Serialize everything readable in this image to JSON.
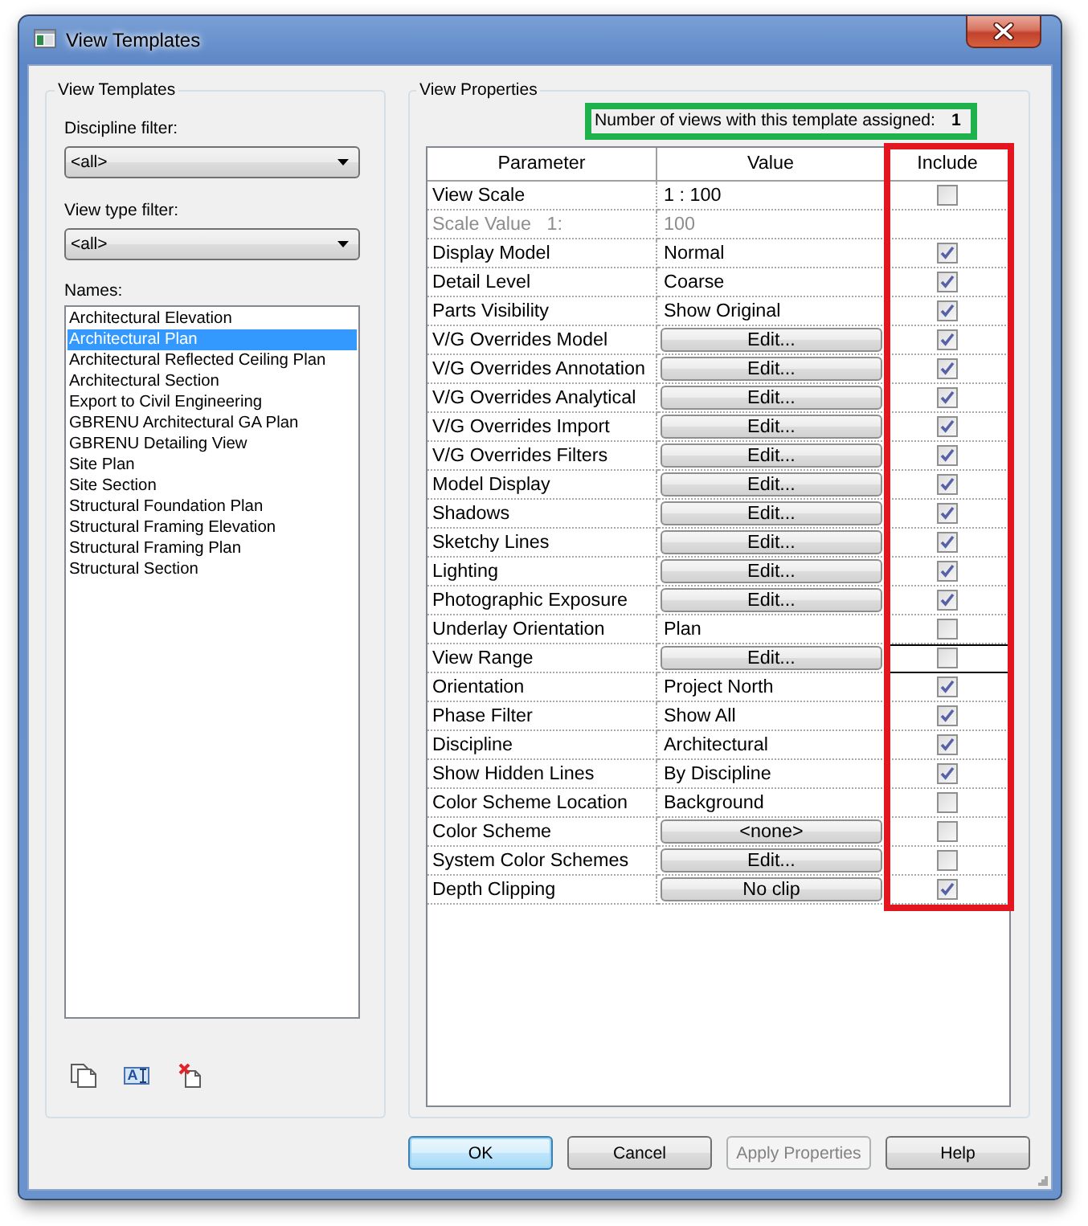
{
  "window": {
    "title": "View Templates"
  },
  "templates_panel": {
    "title": "View Templates",
    "discipline_filter": {
      "label": "Discipline filter:",
      "value": "<all>"
    },
    "view_type_filter": {
      "label": "View type filter:",
      "value": "<all>"
    },
    "names_label": "Names:",
    "names": [
      {
        "label": "Architectural Elevation",
        "selected": false
      },
      {
        "label": "Architectural Plan",
        "selected": true
      },
      {
        "label": "Architectural Reflected Ceiling Plan",
        "selected": false
      },
      {
        "label": "Architectural Section",
        "selected": false
      },
      {
        "label": "Export to Civil Engineering",
        "selected": false
      },
      {
        "label": "GBRENU Architectural GA Plan",
        "selected": false
      },
      {
        "label": "GBRENU Detailing View",
        "selected": false
      },
      {
        "label": "Site Plan",
        "selected": false
      },
      {
        "label": "Site Section",
        "selected": false
      },
      {
        "label": "Structural Foundation Plan",
        "selected": false
      },
      {
        "label": "Structural Framing Elevation",
        "selected": false
      },
      {
        "label": "Structural Framing Plan",
        "selected": false
      },
      {
        "label": "Structural Section",
        "selected": false
      }
    ],
    "tools": [
      {
        "kind": "duplicate"
      },
      {
        "kind": "rename",
        "glyph": "A"
      },
      {
        "kind": "delete"
      }
    ]
  },
  "properties_panel": {
    "title": "View Properties",
    "assigned": {
      "label": "Number of views with this template assigned:",
      "count": "1",
      "highlighted": true
    },
    "columns": [
      {
        "label": "Parameter",
        "highlighted": false
      },
      {
        "label": "Value",
        "highlighted": false
      },
      {
        "label": "Include",
        "highlighted": true
      }
    ],
    "rows": [
      {
        "parameter": "View Scale",
        "value": "1 : 100",
        "kind": "text",
        "checked": false,
        "focused": false
      },
      {
        "parameter": "Scale Value   1:",
        "value": "100",
        "kind": "readonly",
        "focused": false
      },
      {
        "parameter": "Display Model",
        "value": "Normal",
        "kind": "text",
        "checked": true,
        "focused": false
      },
      {
        "parameter": "Detail Level",
        "value": "Coarse",
        "kind": "text",
        "checked": true,
        "focused": false
      },
      {
        "parameter": "Parts Visibility",
        "value": "Show Original",
        "kind": "text",
        "checked": true,
        "focused": false
      },
      {
        "parameter": "V/G Overrides Model",
        "value": "Edit...",
        "kind": "button",
        "checked": true,
        "focused": false
      },
      {
        "parameter": "V/G Overrides Annotation",
        "value": "Edit...",
        "kind": "button",
        "checked": true,
        "focused": false
      },
      {
        "parameter": "V/G Overrides Analytical",
        "value": "Edit...",
        "kind": "button",
        "checked": true,
        "focused": false
      },
      {
        "parameter": "V/G Overrides Import",
        "value": "Edit...",
        "kind": "button",
        "checked": true,
        "focused": false
      },
      {
        "parameter": "V/G Overrides Filters",
        "value": "Edit...",
        "kind": "button",
        "checked": true,
        "focused": false
      },
      {
        "parameter": "Model Display",
        "value": "Edit...",
        "kind": "button",
        "checked": true,
        "focused": false
      },
      {
        "parameter": "Shadows",
        "value": "Edit...",
        "kind": "button",
        "checked": true,
        "focused": false
      },
      {
        "parameter": "Sketchy Lines",
        "value": "Edit...",
        "kind": "button",
        "checked": true,
        "focused": false
      },
      {
        "parameter": "Lighting",
        "value": "Edit...",
        "kind": "button",
        "checked": true,
        "focused": false
      },
      {
        "parameter": "Photographic Exposure",
        "value": "Edit...",
        "kind": "button",
        "checked": true,
        "focused": false
      },
      {
        "parameter": "Underlay Orientation",
        "value": "Plan",
        "kind": "text",
        "checked": false,
        "focused": false
      },
      {
        "parameter": "View Range",
        "value": "Edit...",
        "kind": "button",
        "checked": false,
        "focused": true
      },
      {
        "parameter": "Orientation",
        "value": "Project North",
        "kind": "text",
        "checked": true,
        "focused": false
      },
      {
        "parameter": "Phase Filter",
        "value": "Show All",
        "kind": "text",
        "checked": true,
        "focused": false
      },
      {
        "parameter": "Discipline",
        "value": "Architectural",
        "kind": "text",
        "checked": true,
        "focused": false
      },
      {
        "parameter": "Show Hidden Lines",
        "value": "By Discipline",
        "kind": "text",
        "checked": true,
        "focused": false
      },
      {
        "parameter": "Color Scheme Location",
        "value": "Background",
        "kind": "text",
        "checked": false,
        "focused": false
      },
      {
        "parameter": "Color Scheme",
        "value": "<none>",
        "kind": "button",
        "checked": false,
        "focused": false
      },
      {
        "parameter": "System Color Schemes",
        "value": "Edit...",
        "kind": "button",
        "checked": false,
        "focused": false
      },
      {
        "parameter": "Depth Clipping",
        "value": "No clip",
        "kind": "button",
        "checked": true,
        "focused": false
      }
    ]
  },
  "buttons": [
    {
      "label": "OK",
      "default": true,
      "disabled": false
    },
    {
      "label": "Cancel",
      "default": false,
      "disabled": false
    },
    {
      "label": "Apply Properties",
      "default": false,
      "disabled": true
    },
    {
      "label": "Help",
      "default": false,
      "disabled": false
    }
  ]
}
